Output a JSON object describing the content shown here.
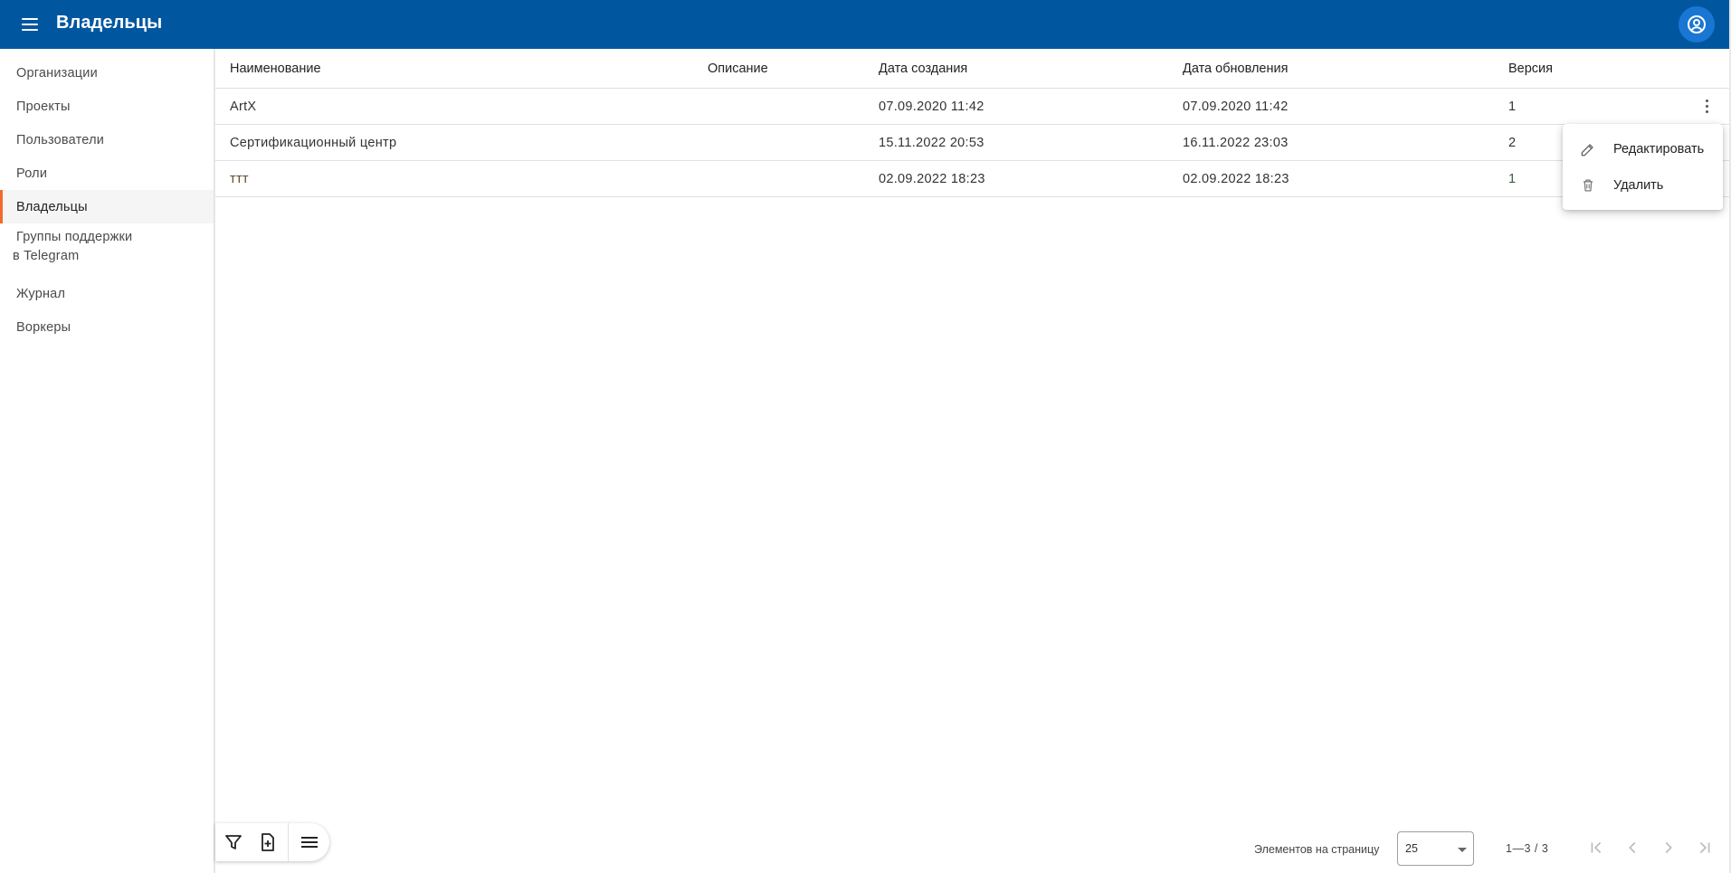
{
  "header": {
    "title": "Владельцы",
    "menu_icon": "menu-icon",
    "account_icon": "account-circle-icon",
    "color": "#0057a0"
  },
  "sidebar": {
    "items": [
      {
        "label": "Организации"
      },
      {
        "label": "Проекты"
      },
      {
        "label": "Пользователи"
      },
      {
        "label": "Роли"
      },
      {
        "label": "Владельцы",
        "active": true
      },
      {
        "label_line1": "Группы поддержки",
        "label_line2": "в Telegram"
      },
      {
        "label": "Журнал"
      },
      {
        "label": "Воркеры"
      }
    ],
    "active_color": "#f26b2c"
  },
  "table": {
    "columns": [
      "Наименование",
      "Описание",
      "Дата создания",
      "Дата обновления",
      "Версия"
    ],
    "rows": [
      {
        "name": "ArtX",
        "description": "",
        "created": "07.09.2020 11:42",
        "updated": "07.09.2020 11:42",
        "version": "1"
      },
      {
        "name": "Сертификационный центр",
        "description": "",
        "created": "15.11.2022 20:53",
        "updated": "16.11.2022 23:03",
        "version": "2"
      },
      {
        "name": "ттт",
        "description": "",
        "created": "02.09.2022 18:23",
        "updated": "02.09.2022 18:23",
        "version": "1"
      }
    ]
  },
  "context_menu": {
    "edit_label": "Редактировать",
    "edit_icon": "pencil-icon",
    "delete_label": "Удалить",
    "delete_icon": "trash-icon"
  },
  "toolbar": {
    "filter_icon": "filter-icon",
    "add_icon": "add-document-icon",
    "columns_icon": "list-icon"
  },
  "paginator": {
    "items_per_page_label": "Элементов на страницу",
    "page_size": "25",
    "range": "1—3 / 3"
  }
}
